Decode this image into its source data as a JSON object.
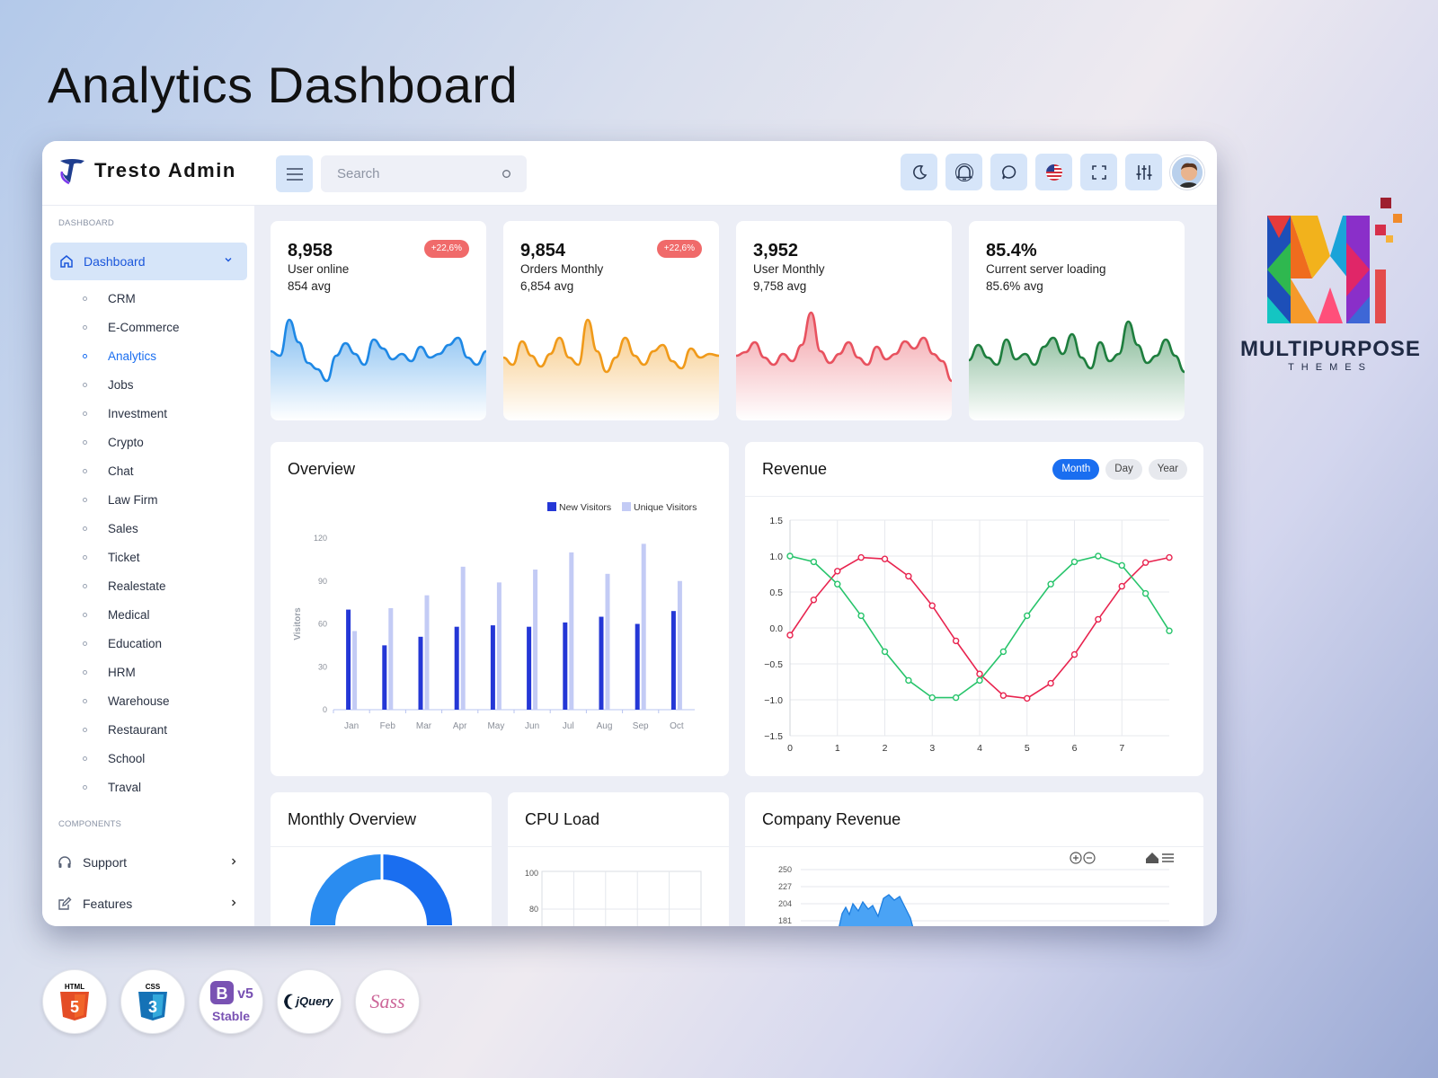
{
  "page": {
    "heading": "Analytics Dashboard"
  },
  "app": {
    "name": "Tresto Admin"
  },
  "search": {
    "placeholder": "Search"
  },
  "sidebar": {
    "section_dashboard": "DASHBOARD",
    "active_label": "Dashboard",
    "items": [
      {
        "label": "CRM"
      },
      {
        "label": "E-Commerce"
      },
      {
        "label": "Analytics"
      },
      {
        "label": "Jobs"
      },
      {
        "label": "Investment"
      },
      {
        "label": "Crypto"
      },
      {
        "label": "Chat"
      },
      {
        "label": "Law Firm"
      },
      {
        "label": "Sales"
      },
      {
        "label": "Ticket"
      },
      {
        "label": "Realestate"
      },
      {
        "label": "Medical"
      },
      {
        "label": "Education"
      },
      {
        "label": "HRM"
      },
      {
        "label": "Warehouse"
      },
      {
        "label": "Restaurant"
      },
      {
        "label": "School"
      },
      {
        "label": "Traval"
      }
    ],
    "active_item": "Analytics",
    "section_components": "COMPONENTS",
    "components": [
      {
        "label": "Support"
      },
      {
        "label": "Features"
      }
    ]
  },
  "stats": [
    {
      "value": "8,958",
      "label": "User online",
      "avg": "854 avg",
      "badge": "+22,6%",
      "color": "#1e88e5"
    },
    {
      "value": "9,854",
      "label": "Orders Monthly",
      "avg": "6,854 avg",
      "badge": "+22,6%",
      "color": "#f09a1a"
    },
    {
      "value": "3,952",
      "label": "User Monthly",
      "avg": "9,758 avg",
      "badge": "",
      "color": "#e8525f"
    },
    {
      "value": "85.4%",
      "label": "Current server loading",
      "avg": "85.6% avg",
      "badge": "",
      "color": "#1e7e3e"
    }
  ],
  "overview": {
    "title": "Overview"
  },
  "revenue": {
    "title": "Revenue",
    "tabs": [
      "Month",
      "Day",
      "Year"
    ],
    "active_tab": "Month"
  },
  "monthly_overview": {
    "title": "Monthly Overview"
  },
  "cpu_load": {
    "title": "CPU Load"
  },
  "company_revenue": {
    "title": "Company Revenue"
  },
  "brand": {
    "name": "MULTIPURPOSE",
    "sub": "THEMES"
  },
  "tech_badges": [
    "HTML5",
    "CSS3",
    "Bootstrap v5 Stable",
    "jQuery",
    "Sass"
  ],
  "tech_text": {
    "bs_version": "v5",
    "bs_status": "Stable"
  },
  "colors": {
    "accent": "#1a6ef0",
    "active_bg": "#d6e5f9",
    "badge": "#f06a6a"
  },
  "chart_data": [
    {
      "type": "bar",
      "categories": [
        "Jan",
        "Feb",
        "Mar",
        "Apr",
        "May",
        "Jun",
        "Jul",
        "Aug",
        "Sep",
        "Oct"
      ],
      "series": [
        {
          "name": "New Visitors",
          "color": "#2437d6",
          "values": [
            70,
            45,
            51,
            58,
            59,
            58,
            61,
            65,
            60,
            69
          ]
        },
        {
          "name": "Unique Visitors",
          "color": "#c3cbf5",
          "values": [
            55,
            71,
            80,
            100,
            89,
            98,
            110,
            95,
            116,
            90
          ]
        }
      ],
      "ylabel": "Visitors",
      "ylim": [
        0,
        120
      ],
      "yticks": [
        0,
        30,
        60,
        90,
        120
      ],
      "legend": "top-right"
    },
    {
      "type": "line",
      "x": [
        0,
        0.5,
        1,
        1.5,
        2,
        2.5,
        3,
        3.5,
        4,
        4.5,
        5,
        5.5,
        6,
        6.5,
        7,
        7.5,
        8
      ],
      "series": [
        {
          "color": "#e8244f",
          "values": [
            -0.1,
            0.39,
            0.79,
            0.98,
            0.96,
            0.72,
            0.31,
            -0.18,
            -0.64,
            -0.94,
            -0.98,
            -0.77,
            -0.37,
            0.12,
            0.58,
            0.91,
            0.98
          ]
        },
        {
          "color": "#27c46b",
          "values": [
            1.0,
            0.92,
            0.61,
            0.17,
            -0.33,
            -0.73,
            -0.97,
            -0.97,
            -0.73,
            -0.33,
            0.17,
            0.61,
            0.92,
            1.0,
            0.87,
            0.48,
            -0.04
          ]
        }
      ],
      "xticks": [
        0,
        1,
        2,
        3,
        4,
        5,
        6,
        7
      ],
      "yticks": [
        1.5,
        1.0,
        0.5,
        0.0,
        -0.5,
        -1.0,
        -1.5
      ],
      "ylim": [
        -1.5,
        1.5
      ]
    },
    {
      "type": "line",
      "yticks": [
        100,
        80
      ],
      "note": "CPU Load (partially visible)"
    },
    {
      "type": "area",
      "yticks": [
        250,
        227,
        204,
        181
      ],
      "note": "Company Revenue (partially visible)"
    }
  ]
}
